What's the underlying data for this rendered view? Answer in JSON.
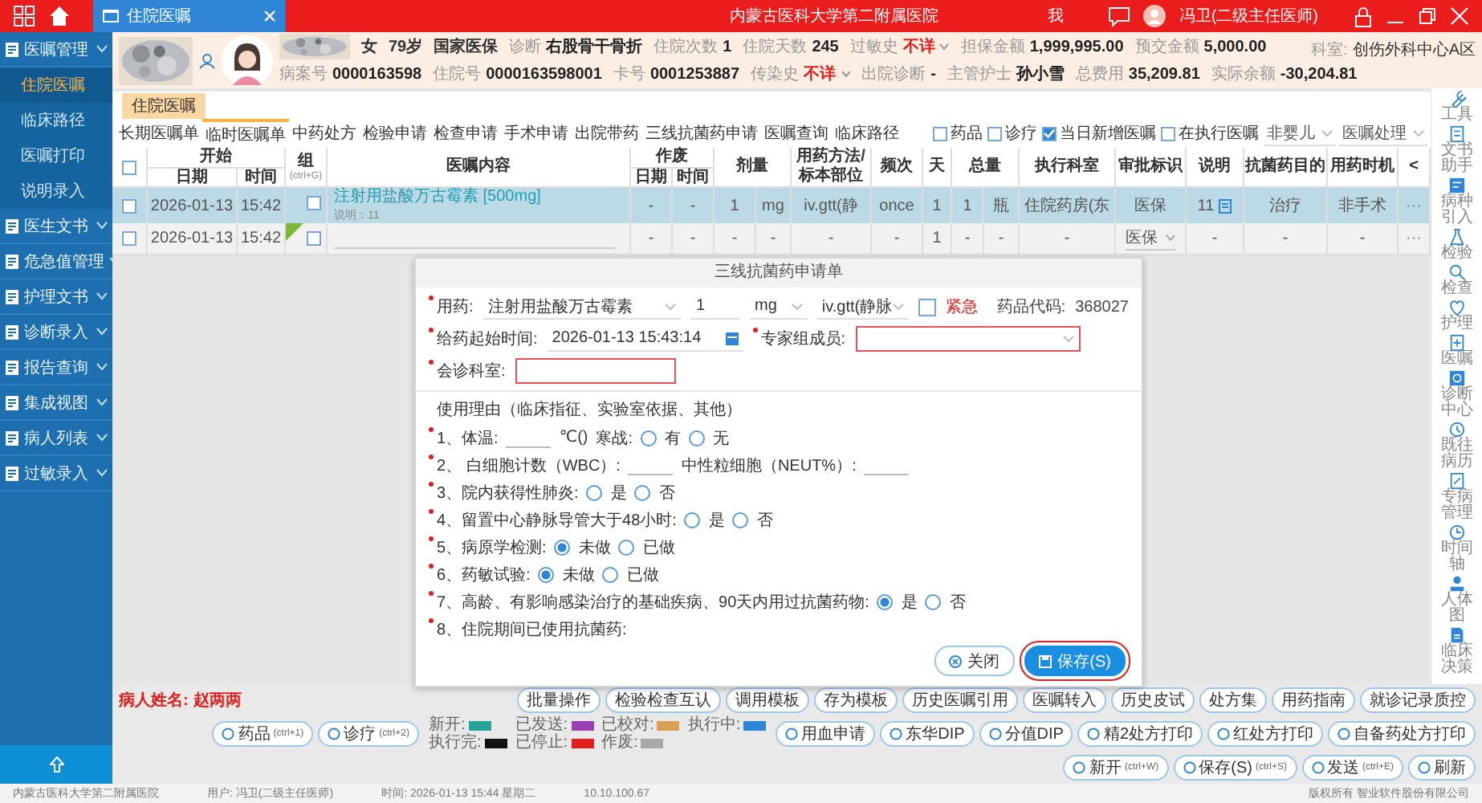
{
  "topbar": {
    "tab": "住院医嘱",
    "hospital": "内蒙古医科大学第二附属医院",
    "me": "我",
    "user": "冯卫(二级主任医师)"
  },
  "patient": {
    "gender": "女",
    "age": "79岁",
    "insurance": "国家医保",
    "row1": [
      {
        "label": "诊断",
        "value": "右股骨干骨折",
        "alert": false
      },
      {
        "label": "住院次数",
        "value": "1",
        "alert": false
      },
      {
        "label": "住院天数",
        "value": "245",
        "alert": false
      },
      {
        "label": "过敏史",
        "value": "不详",
        "alert": true
      },
      {
        "label": "担保金额",
        "value": "1,999,995.00",
        "alert": false
      },
      {
        "label": "预交金额",
        "value": "5,000.00",
        "alert": false
      }
    ],
    "row2": [
      {
        "label": "病案号",
        "value": "0000163598",
        "alert": false
      },
      {
        "label": "住院号",
        "value": "0000163598001",
        "alert": false
      },
      {
        "label": "卡号",
        "value": "0001253887",
        "alert": false
      },
      {
        "label": "传染史",
        "value": "不详",
        "alert": true
      },
      {
        "label": "出院诊断",
        "value": "-",
        "alert": false
      },
      {
        "label": "主管护士",
        "value": "孙小雪",
        "alert": false
      },
      {
        "label": "总费用",
        "value": "35,209.81",
        "alert": false
      },
      {
        "label": "实际余额",
        "value": "-30,204.81",
        "alert": false
      }
    ],
    "dept_label": "科室:",
    "dept": "创伤外科中心A区"
  },
  "sidebar": {
    "items": [
      {
        "label": "医嘱管理",
        "kind": "group",
        "selected": false
      },
      {
        "label": "住院医嘱",
        "kind": "item",
        "selected": true
      },
      {
        "label": "临床路径",
        "kind": "item",
        "selected": false
      },
      {
        "label": "医嘱打印",
        "kind": "item",
        "selected": false
      },
      {
        "label": "说明录入",
        "kind": "item",
        "selected": false
      },
      {
        "label": "医生文书",
        "kind": "group",
        "selected": false
      },
      {
        "label": "危急值管理",
        "kind": "group",
        "selected": false
      },
      {
        "label": "护理文书",
        "kind": "group",
        "selected": false
      },
      {
        "label": "诊断录入",
        "kind": "group",
        "selected": false
      },
      {
        "label": "报告查询",
        "kind": "group",
        "selected": false
      },
      {
        "label": "集成视图",
        "kind": "group",
        "selected": false
      },
      {
        "label": "病人列表",
        "kind": "group",
        "selected": false
      },
      {
        "label": "过敏录入",
        "kind": "group",
        "selected": false
      }
    ]
  },
  "page_tab": "住院医嘱",
  "tabs": [
    {
      "label": "长期医嘱单",
      "selected": false
    },
    {
      "label": "临时医嘱单",
      "selected": true
    },
    {
      "label": "中药处方",
      "selected": false
    },
    {
      "label": "检验申请",
      "selected": false
    },
    {
      "label": "检查申请",
      "selected": false
    },
    {
      "label": "手术申请",
      "selected": false
    },
    {
      "label": "出院带药",
      "selected": false
    },
    {
      "label": "三线抗菌药申请",
      "selected": false
    },
    {
      "label": "医嘱查询",
      "selected": false
    },
    {
      "label": "临床路径",
      "selected": false
    }
  ],
  "filters": [
    {
      "label": "药品",
      "checked": false
    },
    {
      "label": "诊疗",
      "checked": false
    },
    {
      "label": "当日新增医嘱",
      "checked": true
    },
    {
      "label": "在执行医嘱",
      "checked": false
    }
  ],
  "selects": [
    "非婴儿",
    "医嘱处理"
  ],
  "table": {
    "all_checked": false,
    "columns": [
      {
        "kind": "grouped",
        "group": "开始",
        "label": "日期"
      },
      {
        "kind": "sub",
        "label": "时间"
      },
      {
        "kind": "plain",
        "label": "组",
        "hint": "(ctrl+G)"
      },
      {
        "kind": "plain",
        "label": "医嘱内容"
      },
      {
        "kind": "grouped",
        "group": "作废",
        "label": "日期"
      },
      {
        "kind": "sub",
        "label": "时间"
      },
      {
        "kind": "plain",
        "label": "剂量"
      },
      {
        "kind": "unit"
      },
      {
        "kind": "plain",
        "label": "用药方法/标本部位"
      },
      {
        "kind": "plain",
        "label": "频次"
      },
      {
        "kind": "plain",
        "label": "天"
      },
      {
        "kind": "plain",
        "label": "总量"
      },
      {
        "kind": "unit"
      },
      {
        "kind": "plain",
        "label": "执行科室"
      },
      {
        "kind": "plain",
        "label": "审批标识"
      },
      {
        "kind": "plain",
        "label": "说明"
      },
      {
        "kind": "plain",
        "label": "抗菌药目的"
      },
      {
        "kind": "plain",
        "label": "用药时机"
      },
      {
        "kind": "plain",
        "label": "<"
      }
    ],
    "rows": [
      {
        "selected": true,
        "checked": false,
        "new_flag": false,
        "editable": false,
        "group_checked": false,
        "note": "说明：11",
        "cells": [
          "2026-01-13",
          "15:42",
          "",
          "注射用盐酸万古霉素 [500mg]",
          "-",
          "-",
          "1",
          "mg",
          "iv.gtt(静",
          "once",
          "1",
          "1",
          "瓶",
          "住院药房(东",
          "医保",
          "11",
          "治疗",
          "非手术",
          "···"
        ]
      },
      {
        "selected": false,
        "checked": false,
        "new_flag": true,
        "editable": true,
        "group_checked": false,
        "cells": [
          "2026-01-13",
          "15:42",
          "",
          "",
          "-",
          "-",
          "-",
          "-",
          "-",
          "-",
          "1",
          "-",
          "-",
          "-",
          "医保",
          "-",
          "-",
          "-",
          "···"
        ]
      }
    ]
  },
  "dialog": {
    "title": "三线抗菌药申请单",
    "drug_label": "用药:",
    "drug": "注射用盐酸万古霉素",
    "dose": "1",
    "unit": "mg",
    "route": "iv.gtt(静脉",
    "urgent_label": "紧急",
    "urgent": false,
    "code_label": "药品代码:",
    "code": "368027",
    "start_label": "给药起始时间:",
    "start": "2026-01-13 15:43:14",
    "expert_label": "专家组成员:",
    "dept_label": "会诊科室:",
    "reason_title": "使用理由（临床指征、实验室依据、其他）",
    "questions": [
      {
        "parts": [
          {
            "kind": "text",
            "text": "1、体温:"
          },
          {
            "kind": "blank"
          },
          {
            "kind": "text",
            "text": "℃()"
          },
          {
            "kind": "text",
            "text": "寒战:"
          },
          {
            "kind": "radio",
            "label": "有",
            "selected": false
          },
          {
            "kind": "radio",
            "label": "无",
            "selected": false
          }
        ]
      },
      {
        "parts": [
          {
            "kind": "text",
            "text": "2、 白细胞计数（WBC）:"
          },
          {
            "kind": "blank"
          },
          {
            "kind": "text",
            "text": "中性粒细胞（NEUT%）:"
          },
          {
            "kind": "blank"
          }
        ]
      },
      {
        "parts": [
          {
            "kind": "text",
            "text": "3、院内获得性肺炎:"
          },
          {
            "kind": "radio",
            "label": "是",
            "selected": false
          },
          {
            "kind": "radio",
            "label": "否",
            "selected": false
          }
        ]
      },
      {
        "parts": [
          {
            "kind": "text",
            "text": "4、留置中心静脉导管大于48小时:"
          },
          {
            "kind": "radio",
            "label": "是",
            "selected": false
          },
          {
            "kind": "radio",
            "label": "否",
            "selected": false
          }
        ]
      },
      {
        "parts": [
          {
            "kind": "text",
            "text": "5、病原学检测:"
          },
          {
            "kind": "radio",
            "label": "未做",
            "selected": true
          },
          {
            "kind": "radio",
            "label": "已做",
            "selected": false
          }
        ]
      },
      {
        "parts": [
          {
            "kind": "text",
            "text": "6、药敏试验:"
          },
          {
            "kind": "radio",
            "label": "未做",
            "selected": true
          },
          {
            "kind": "radio",
            "label": "已做",
            "selected": false
          }
        ]
      },
      {
        "parts": [
          {
            "kind": "text",
            "text": "7、高龄、有影响感染治疗的基础疾病、90天内用过抗菌药物:"
          },
          {
            "kind": "radio",
            "label": "是",
            "selected": true
          },
          {
            "kind": "radio",
            "label": "否",
            "selected": false
          }
        ]
      },
      {
        "parts": [
          {
            "kind": "text",
            "text": "8、住院期间已使用抗菌药:"
          }
        ]
      }
    ],
    "buttons": [
      {
        "label": "关闭",
        "primary": false
      },
      {
        "label": "保存(S)",
        "primary": true
      }
    ]
  },
  "bottom": {
    "name_label": "病人姓名:",
    "name": "赵两两",
    "row1": [
      "批量操作",
      "检验检查互认",
      "调用模板",
      "存为模板",
      "历史医嘱引用",
      "医嘱转入",
      "历史皮试",
      "处方集",
      "用药指南",
      "就诊记录质控"
    ],
    "quick": [
      {
        "label": "药品",
        "shortcut": "(ctrl+1)"
      },
      {
        "label": "诊疗",
        "shortcut": "(ctrl+2)"
      }
    ],
    "legend": [
      {
        "label": "新开:",
        "color": "#2aa198"
      },
      {
        "label": "执行完:",
        "color": "#111111"
      },
      {
        "label": "已发送:",
        "color": "#9b3fb5"
      },
      {
        "label": "已停止:",
        "color": "#e0201c"
      },
      {
        "label": "已校对:",
        "color": "#d9a055"
      },
      {
        "label": "作废:",
        "color": "#a8a8a8"
      },
      {
        "label": "执行中:",
        "color": "#2f86d6"
      }
    ],
    "row2": [
      {
        "label": "用血申请"
      },
      {
        "label": "东华DIP"
      },
      {
        "label": "分值DIP"
      },
      {
        "label": "精2处方打印"
      },
      {
        "label": "红处方打印"
      },
      {
        "label": "自备药处方打印"
      },
      {
        "label": "新开",
        "shortcut": "(ctrl+W)"
      },
      {
        "label": "保存(S)",
        "shortcut": "(ctrl+S)"
      },
      {
        "label": "发送",
        "shortcut": "(ctrl+E)"
      },
      {
        "label": "刷新"
      }
    ]
  },
  "status_bar": [
    "内蒙古医科大学第二附属医院",
    "用户: 冯卫(二级主任医师)",
    "时间: 2026-01-13 15:44 星期二",
    "10.10.100.67",
    "版权所有 智业软件股份有限公司"
  ],
  "toolbar": [
    "工具",
    "文书助手",
    "病种引入",
    "检验",
    "检查",
    "护理",
    "医嘱",
    "诊断中心",
    "既往病历",
    "专病管理",
    "时间轴",
    "人体图",
    "临床决策"
  ]
}
